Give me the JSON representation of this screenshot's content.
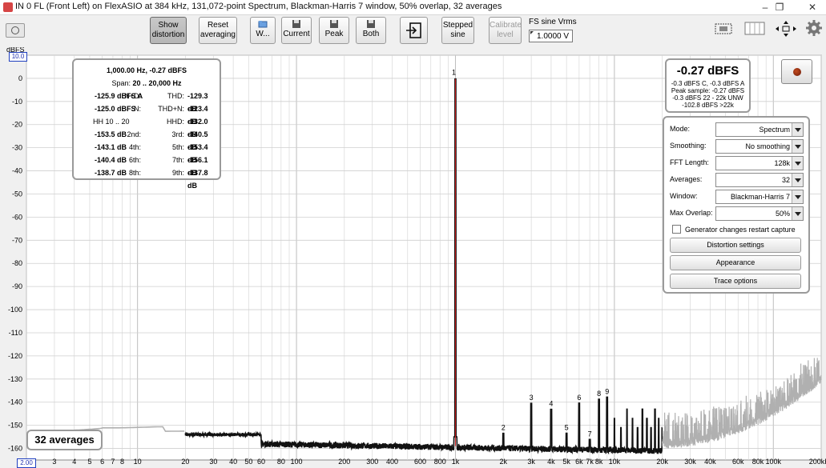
{
  "window": {
    "title": "IN 0 FL (Front Left) on FlexASIO at 384 kHz, 131,072-point Spectrum, Blackman-Harris 7 window, 50% overlap, 32 averages",
    "controls": [
      "–",
      "❐",
      "✕"
    ]
  },
  "toolbar": {
    "show_distortion": [
      "Show",
      "distortion"
    ],
    "reset_averaging": [
      "Reset",
      "averaging"
    ],
    "w": "W...",
    "current": "Current",
    "peak": "Peak",
    "both": "Both",
    "stepped_sine": [
      "Stepped",
      "sine"
    ],
    "calibrate_level": [
      "Calibrate",
      "level"
    ],
    "fs_label": "FS sine Vrms",
    "fs_value": "1.0000 V"
  },
  "axes": {
    "y_unit": "dBFS",
    "y_top_box": "10.0",
    "x_left_box": "2.00",
    "y_ticks": [
      "0",
      "-10",
      "-20",
      "-30",
      "-40",
      "-50",
      "-60",
      "-70",
      "-80",
      "-90",
      "-100",
      "-110",
      "-120",
      "-130",
      "-140",
      "-150",
      "-160"
    ],
    "x_ticks": [
      "3",
      "4",
      "5",
      "6",
      "7",
      "8",
      "10",
      "20",
      "30",
      "40",
      "50",
      "60",
      "80",
      "100",
      "200",
      "300",
      "400",
      "600",
      "800",
      "1k",
      "2k",
      "3k",
      "4k",
      "5k",
      "6k",
      "7k",
      "8k",
      "10k",
      "20k",
      "30k",
      "40k",
      "60k",
      "80k",
      "100k",
      "200kHz"
    ]
  },
  "distortion_panel": {
    "header": "1,000.00 Hz, -0.27 dBFS",
    "span_label": "Span:",
    "span_value": "20 .. 20,000 Hz",
    "nd_label": "N+D:",
    "nd_value": "-125.9 dBFS A",
    "thd_label": "THD:",
    "thd_value": "-129.3 dB",
    "n_label": "N:",
    "n_value": "-125.0 dBFS",
    "thdn_label": "THD+N:",
    "thdn_value": "-123.4 dB",
    "hh_label": "HH 10 .. 20",
    "hhd_label": "HHD:",
    "hhd_value": "-132.0 dB",
    "h2_label": "2nd:",
    "h2_value": "-153.5 dB",
    "h3_label": "3rd:",
    "h3_value": "-140.5 dB",
    "h4_label": "4th:",
    "h4_value": "-143.1 dB",
    "h5_label": "5th:",
    "h5_value": "-153.4 dB",
    "h6_label": "6th:",
    "h6_value": "-140.4 dB",
    "h7_label": "7th:",
    "h7_value": "-156.1 dB",
    "h8_label": "8th:",
    "h8_value": "-138.7 dB",
    "h9_label": "9th:",
    "h9_value": "-137.8 dB"
  },
  "level_panel": {
    "value": "-0.27 dBFS",
    "line1": "-0.3 dBFS C, -0.3 dBFS A",
    "line2": "Peak sample: -0.27 dBFS",
    "line3": "-0.3 dBFS 22 - 22k UNW",
    "line4": "-102.8 dBFS >22k"
  },
  "settings": {
    "mode_label": "Mode:",
    "mode_value": "Spectrum",
    "smoothing_label": "Smoothing:",
    "smoothing_value": "No  smoothing",
    "fft_label": "FFT Length:",
    "fft_value": "128k",
    "averages_label": "Averages:",
    "averages_value": "32",
    "window_label": "Window:",
    "window_value": "Blackman-Harris 7",
    "overlap_label": "Max Overlap:",
    "overlap_value": "50%",
    "generator_checkbox": "Generator changes restart capture",
    "distortion_settings": "Distortion settings",
    "appearance": "Appearance",
    "trace_options": "Trace options"
  },
  "averages_badge": "32 averages",
  "chart_data": {
    "type": "line",
    "title": "",
    "xlabel": "",
    "ylabel": "dBFS",
    "x_scale": "log",
    "xlim": [
      2,
      200000
    ],
    "ylim": [
      -165,
      10
    ],
    "grid": true,
    "fundamental": {
      "freq": 1000,
      "level": -0.27,
      "label": "1"
    },
    "harmonics": [
      {
        "label": "2",
        "freq": 2000,
        "level": -153.5
      },
      {
        "label": "3",
        "freq": 3000,
        "level": -140.5
      },
      {
        "label": "4",
        "freq": 4000,
        "level": -143.1
      },
      {
        "label": "5",
        "freq": 5000,
        "level": -153.4
      },
      {
        "label": "6",
        "freq": 6000,
        "level": -140.4
      },
      {
        "label": "7",
        "freq": 7000,
        "level": -156.1
      },
      {
        "label": "8",
        "freq": 8000,
        "level": -138.7
      },
      {
        "label": "9",
        "freq": 9000,
        "level": -137.8
      }
    ],
    "noise_floor_db": -160,
    "colors": {
      "trace": "#111111",
      "trace_out_of_span": "#b0b0b0",
      "fundamental": "#cc2020",
      "grid": "#d8d8d8"
    }
  }
}
